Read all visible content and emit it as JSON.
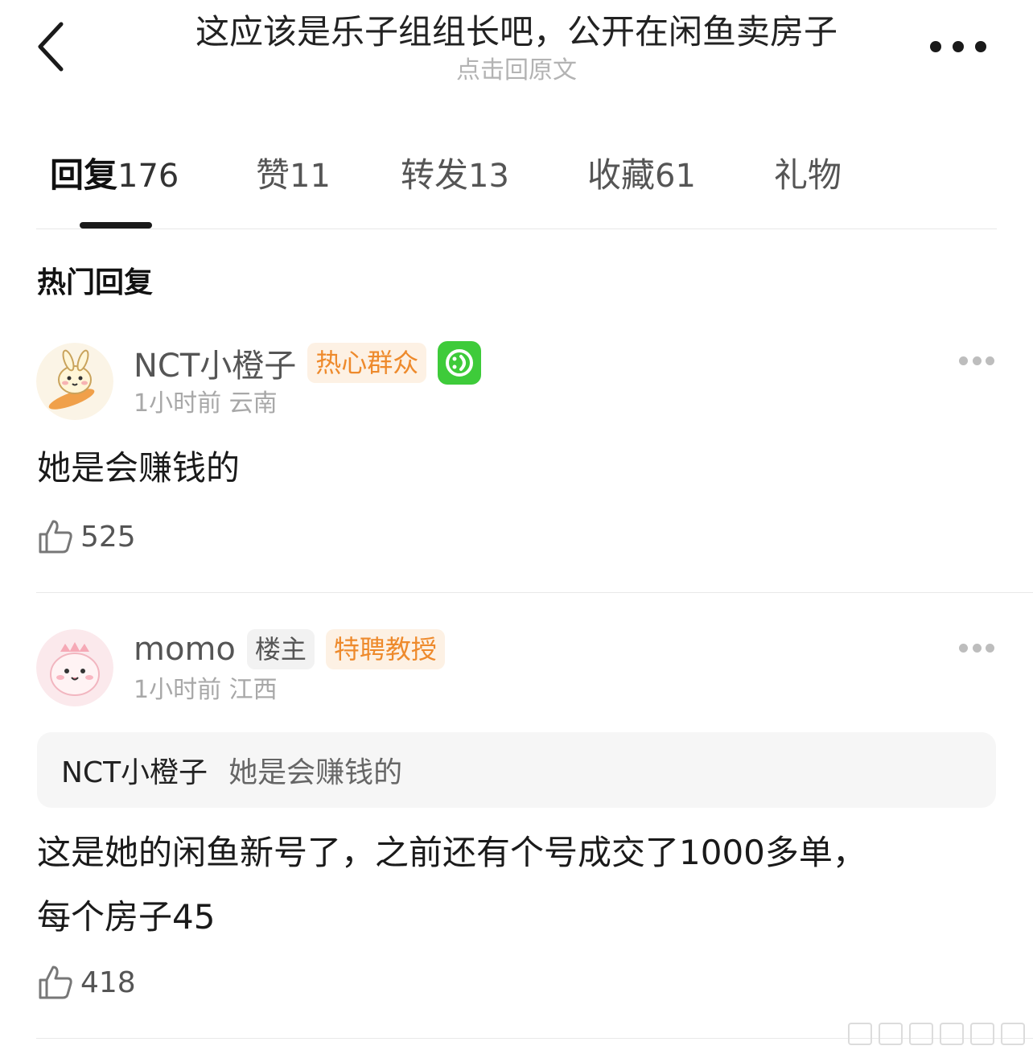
{
  "header": {
    "title": "这应该是乐子组组长吧，公开在闲鱼卖房子",
    "subtitle": "点击回原文",
    "back_icon": "chevron-left-icon",
    "more_icon": "more-horizontal-icon"
  },
  "tabs": [
    {
      "label": "回复",
      "count": "176",
      "active": true
    },
    {
      "label": "赞",
      "count": "11",
      "active": false
    },
    {
      "label": "转发",
      "count": "13",
      "active": false
    },
    {
      "label": "收藏",
      "count": "61",
      "active": false
    },
    {
      "label": "礼物",
      "count": "",
      "active": false
    }
  ],
  "section_title": "热门回复",
  "comments": [
    {
      "username": "NCT小橙子",
      "badges": [
        "热心群众"
      ],
      "vip_icon": "vip-icon",
      "time": "1小时前",
      "location": "云南",
      "text": "她是会赚钱的",
      "likes": "525"
    },
    {
      "username": "momo",
      "badges": [
        "楼主",
        "特聘教授"
      ],
      "time": "1小时前",
      "location": "江西",
      "quote": {
        "user": "NCT小橙子",
        "text": "她是会赚钱的"
      },
      "text_line1": "这是她的闲鱼新号了，之前还有个号成交了1000多单，",
      "text_line2": "每个房子45",
      "likes": "418"
    }
  ],
  "colors": {
    "badge_orange": "#ee8a2c",
    "badge_orange_bg": "#fdf1e4",
    "vip_green": "#3ecb3a",
    "text_primary": "#1a1a1a",
    "text_muted": "#a8a8a8"
  }
}
